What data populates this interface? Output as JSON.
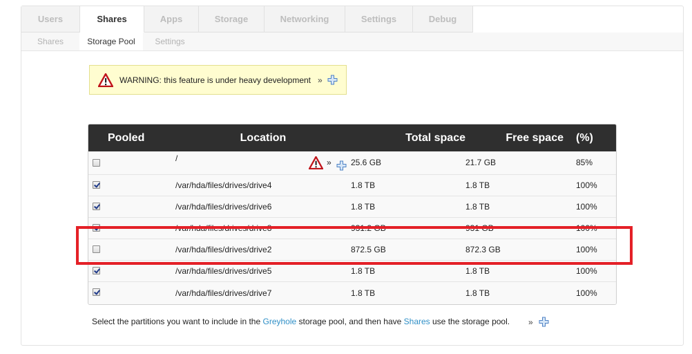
{
  "tabs": [
    "Users",
    "Shares",
    "Apps",
    "Storage",
    "Networking",
    "Settings",
    "Debug"
  ],
  "active_tab": "Shares",
  "subtabs": [
    "Shares",
    "Storage Pool",
    "Settings"
  ],
  "active_subtab": "Storage Pool",
  "warning": {
    "text": "WARNING: this feature is under heavy development",
    "more": "»"
  },
  "table": {
    "headers": {
      "pooled": "Pooled",
      "location": "Location",
      "total": "Total space",
      "free": "Free space",
      "percent": "(%)"
    },
    "rows": [
      {
        "checked": false,
        "location": "/",
        "total": "25.6 GB",
        "free": "21.7 GB",
        "percent": "85%",
        "more": "»"
      },
      {
        "checked": true,
        "location": "/var/hda/files/drives/drive4",
        "total": "1.8 TB",
        "free": "1.8 TB",
        "percent": "100%"
      },
      {
        "checked": true,
        "location": "/var/hda/files/drives/drive6",
        "total": "1.8 TB",
        "free": "1.8 TB",
        "percent": "100%"
      },
      {
        "checked": true,
        "location": "/var/hda/files/drives/drive8",
        "total": "931.2 GB",
        "free": "931 GB",
        "percent": "100%"
      },
      {
        "checked": false,
        "location": "/var/hda/files/drives/drive2",
        "total": "872.5 GB",
        "free": "872.3 GB",
        "percent": "100%"
      },
      {
        "checked": true,
        "location": "/var/hda/files/drives/drive5",
        "total": "1.8 TB",
        "free": "1.8 TB",
        "percent": "100%"
      },
      {
        "checked": true,
        "location": "/var/hda/files/drives/drive7",
        "total": "1.8 TB",
        "free": "1.8 TB",
        "percent": "100%"
      }
    ]
  },
  "footer": {
    "before": "Select the partitions you want to include in the ",
    "link1": "Greyhole",
    "middle": " storage pool, and then have ",
    "link2": "Shares",
    "after": " use the storage pool.",
    "more": "»"
  },
  "colors": {
    "header_bg": "#2f2f2f",
    "warning_bg": "#fffdd0",
    "link": "#2f8fc7",
    "highlight": "#e42027"
  }
}
